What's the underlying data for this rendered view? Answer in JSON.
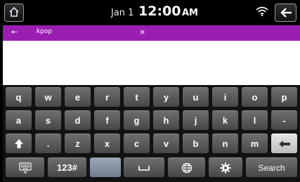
{
  "status_bar": {
    "date": "Jan 1",
    "time": "12:00",
    "ampm": "AM",
    "home_icon": "home-icon",
    "wifi_icon": "wifi-icon",
    "back_icon": "back-arrow-icon"
  },
  "search_bar": {
    "back_glyph": "←",
    "query": "kpop",
    "clear_glyph": "×",
    "accent_color": "#9a1fb0"
  },
  "keyboard": {
    "row1": [
      "q",
      "w",
      "e",
      "r",
      "t",
      "y",
      "u",
      "i",
      "o",
      "p"
    ],
    "row2": [
      "a",
      "s",
      "d",
      "f",
      "g",
      "h",
      "j",
      "k",
      "l",
      "-"
    ],
    "row3": [
      ".",
      "z",
      "x",
      "c",
      "v",
      "b",
      "n",
      "m"
    ],
    "bottom": {
      "numbers_label": "123#",
      "search_label": "Search"
    }
  }
}
